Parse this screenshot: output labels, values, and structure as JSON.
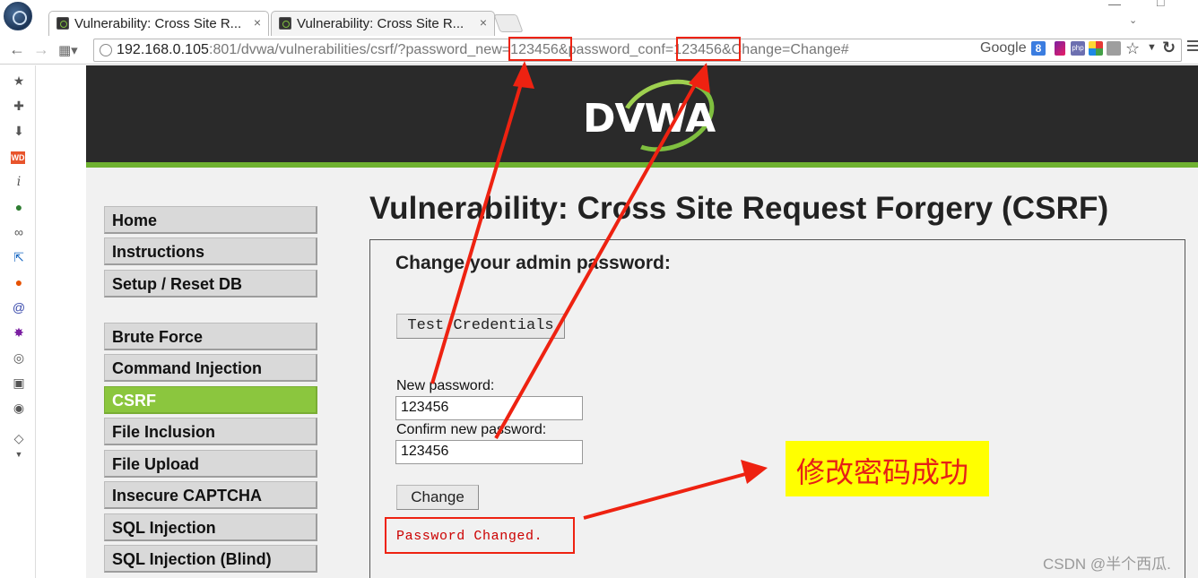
{
  "browser": {
    "tabs": [
      {
        "title": "Vulnerability: Cross Site R...",
        "close": "×",
        "active": true
      },
      {
        "title": "Vulnerability: Cross Site R...",
        "close": "×",
        "active": false
      }
    ],
    "url": {
      "host": "192.168.0.105",
      "rest": ":801/dvwa/vulnerabilities/csrf/?password_new=123456&password_conf=123456&Change=Change#"
    },
    "search_engine": "Google",
    "search_engine_badge": "8",
    "php_badge": "php"
  },
  "extensions": [
    "star-icon",
    "puzzle-icon",
    "download-icon",
    "web-developer-icon",
    "info-icon",
    "green-ball-icon",
    "link-icon",
    "selector-icon",
    "firebug-icon",
    "swirl-icon",
    "bug-icon",
    "palette-icon",
    "qr-icon",
    "globe-icon",
    "eraser-icon"
  ],
  "dvwa": {
    "logo_text": "DVWA",
    "page_title": "Vulnerability: Cross Site Request Forgery (CSRF)",
    "menu_group1": [
      "Home",
      "Instructions",
      "Setup / Reset DB"
    ],
    "menu_group2": [
      "Brute Force",
      "Command Injection",
      "CSRF",
      "File Inclusion",
      "File Upload",
      "Insecure CAPTCHA",
      "SQL Injection",
      "SQL Injection (Blind)"
    ],
    "active_menu": "CSRF",
    "box_heading": "Change your admin password:",
    "test_button": "Test Credentials",
    "new_password_label": "New password:",
    "new_password_value": "123456",
    "confirm_password_label": "Confirm new password:",
    "confirm_password_value": "123456",
    "change_button": "Change",
    "result_message": "Password Changed."
  },
  "annotation": {
    "callout_text": "修改密码成功",
    "color": "#ee2211",
    "callout_bg": "#ffff00"
  },
  "watermark": "CSDN @半个西瓜."
}
